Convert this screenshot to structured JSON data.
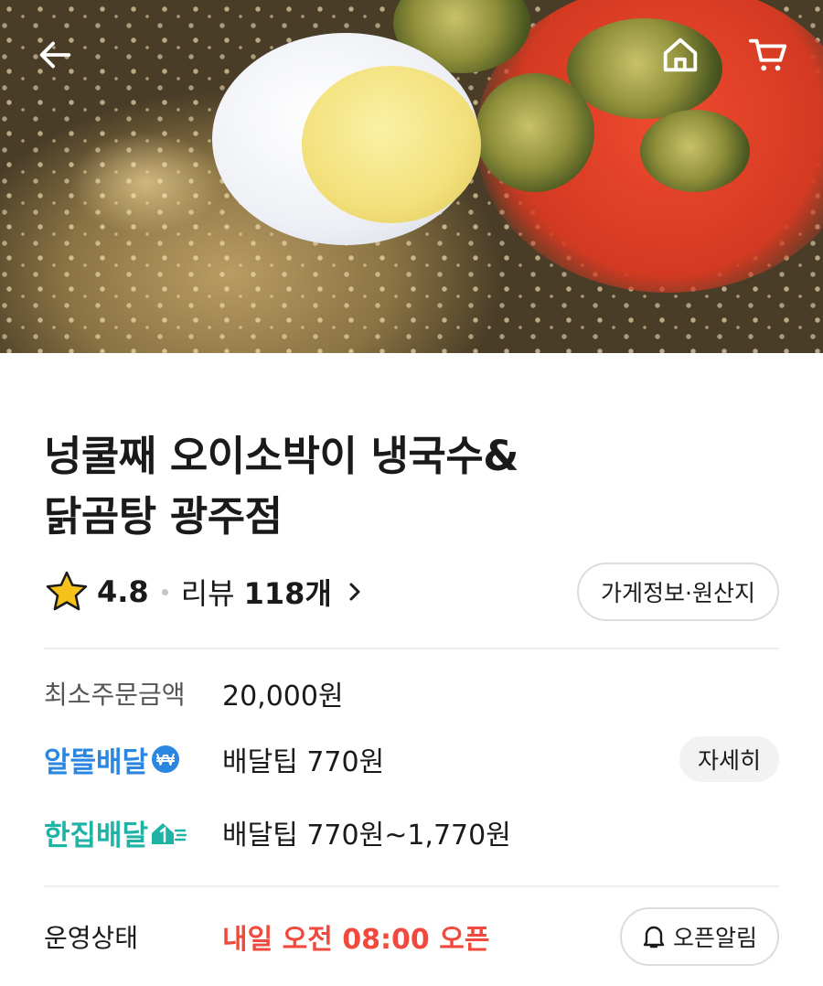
{
  "hero": {
    "back_icon": "arrow-left-icon",
    "home_icon": "home-icon",
    "cart_icon": "cart-icon"
  },
  "store": {
    "title_line1": "넝쿨째 오이소박이 냉국수&",
    "title_line2": "닭곰탕 광주점",
    "rating": "4.8",
    "review_label": "리뷰",
    "review_count": "118개",
    "info_button": "가게정보·원산지"
  },
  "details": {
    "min_order_label": "최소주문금액",
    "min_order_value": "20,000원",
    "budget_delivery_label": "알뜰배달",
    "budget_delivery_fee": "배달팁 770원",
    "detail_button": "자세히",
    "single_delivery_label": "한집배달",
    "single_delivery_fee": "배달팁 770원~1,770원",
    "status_label": "운영상태",
    "status_value": "내일 오전 08:00 오픈",
    "alarm_button": "오픈알림"
  },
  "colors": {
    "star": "#f5c21b",
    "budget_blue": "#2a86e0",
    "single_teal": "#1fb3a6",
    "status_red": "#f0493d"
  }
}
